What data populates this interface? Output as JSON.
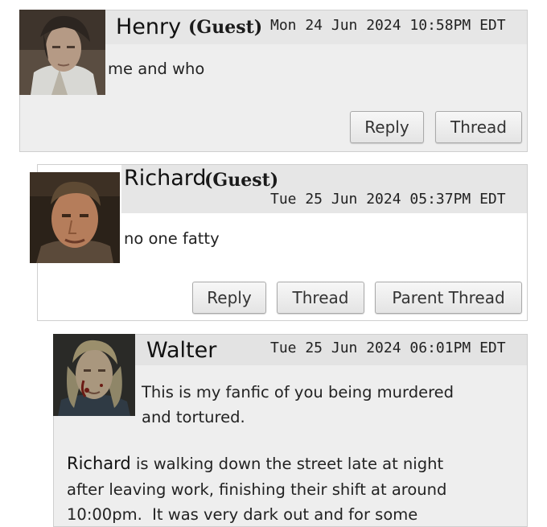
{
  "posts": [
    {
      "author": "Henry",
      "guest_tag": "(Guest)",
      "date": "Mon 24 Jun 2024 10:58PM EDT",
      "body": "me and who",
      "buttons": {
        "reply": "Reply",
        "thread": "Thread"
      }
    },
    {
      "author": "Richard",
      "guest_tag": "(Guest)",
      "date": "Tue 25 Jun 2024 05:37PM EDT",
      "body": "no one fatty",
      "buttons": {
        "reply": "Reply",
        "thread": "Thread",
        "parent_thread": "Parent Thread"
      }
    },
    {
      "author": "Walter",
      "date": "Tue 25 Jun 2024 06:01PM EDT",
      "body_intro_1": "This is my fanfic of you being murdered",
      "body_intro_2": "and tortured.",
      "story_name": "Richard",
      "story_line_1_rest": " is walking down the street late at night",
      "story_line_2": "after leaving work, finishing their shift at around",
      "story_line_3": "10:00pm.  It was very dark out and for some"
    }
  ],
  "colors": {
    "header_bg": "#e6e6e6",
    "panel_bg": "#eeeeee",
    "border": "#cfcfcf"
  }
}
